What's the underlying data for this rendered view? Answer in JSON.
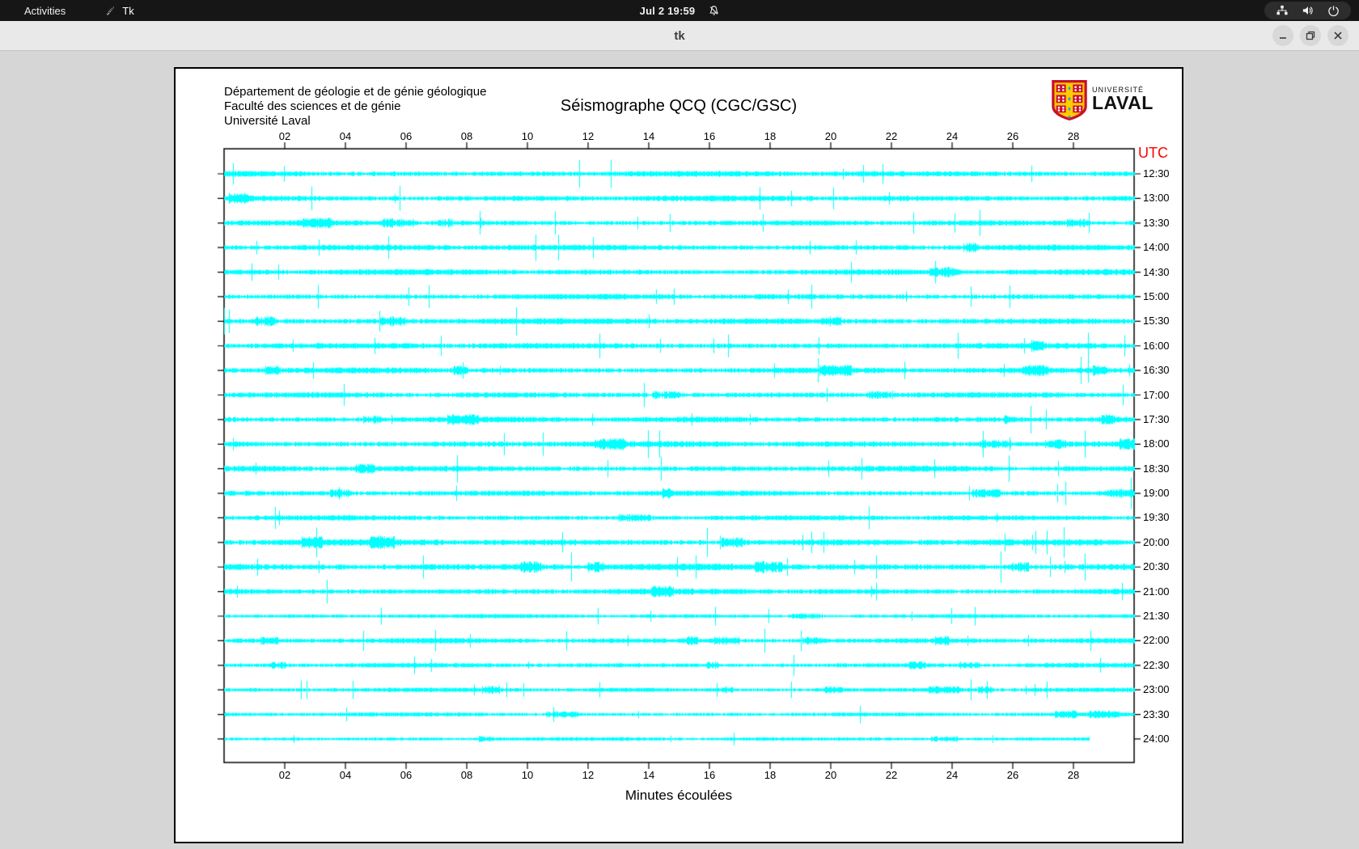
{
  "top_bar": {
    "activities_label": "Activities",
    "app_label": "Tk",
    "clock": "Jul 2 19:59"
  },
  "window": {
    "title": "tk"
  },
  "document": {
    "address_lines": [
      "Département de géologie et de génie géologique",
      "Faculté des sciences et de génie",
      "Université Laval"
    ],
    "title": "Séismographe QCQ (CGC/GSC)",
    "logo": {
      "institution_small": "UNIVERSITÉ",
      "institution_large": "LAVAL"
    }
  },
  "plot": {
    "utc_label": "UTC",
    "utc_color": "#ff0000",
    "xlabel": "Minutes écoulées",
    "trace_color": "#00ffff",
    "frame_color": "#000000",
    "x_tick_labels": [
      "02",
      "04",
      "06",
      "08",
      "10",
      "12",
      "14",
      "16",
      "18",
      "20",
      "22",
      "24",
      "26",
      "28"
    ],
    "row_labels": [
      "12:30",
      "13:00",
      "13:30",
      "14:00",
      "14:30",
      "15:00",
      "15:30",
      "16:00",
      "16:30",
      "17:00",
      "17:30",
      "18:00",
      "18:30",
      "19:00",
      "19:30",
      "20:00",
      "20:30",
      "21:00",
      "21:30",
      "22:00",
      "22:30",
      "23:00",
      "23:30",
      "24:00"
    ]
  },
  "chart_data": {
    "type": "line",
    "subtype": "seismogram-helicorder",
    "title": "Séismographe QCQ (CGC/GSC)",
    "xlabel": "Minutes écoulées",
    "right_axis_label": "UTC",
    "x_range_minutes": [
      0,
      30
    ],
    "x_ticks": [
      2,
      4,
      6,
      8,
      10,
      12,
      14,
      16,
      18,
      20,
      22,
      24,
      26,
      28
    ],
    "trace_color": "#00ffff",
    "rows": [
      {
        "utc": "12:30",
        "start_min": 0,
        "end_min": 30,
        "intensity": 1.0
      },
      {
        "utc": "13:00",
        "start_min": 0,
        "end_min": 30,
        "intensity": 1.0
      },
      {
        "utc": "13:30",
        "start_min": 0,
        "end_min": 30,
        "intensity": 0.95
      },
      {
        "utc": "14:00",
        "start_min": 0,
        "end_min": 30,
        "intensity": 1.0
      },
      {
        "utc": "14:30",
        "start_min": 0,
        "end_min": 30,
        "intensity": 1.0
      },
      {
        "utc": "15:00",
        "start_min": 0,
        "end_min": 30,
        "intensity": 0.95
      },
      {
        "utc": "15:30",
        "start_min": 0,
        "end_min": 30,
        "intensity": 1.05
      },
      {
        "utc": "16:00",
        "start_min": 0,
        "end_min": 30,
        "intensity": 1.0
      },
      {
        "utc": "16:30",
        "start_min": 0,
        "end_min": 30,
        "intensity": 1.0
      },
      {
        "utc": "17:00",
        "start_min": 0,
        "end_min": 30,
        "intensity": 0.95
      },
      {
        "utc": "17:30",
        "start_min": 0,
        "end_min": 30,
        "intensity": 1.0
      },
      {
        "utc": "18:00",
        "start_min": 0,
        "end_min": 30,
        "intensity": 1.05
      },
      {
        "utc": "18:30",
        "start_min": 0,
        "end_min": 30,
        "intensity": 1.0
      },
      {
        "utc": "19:00",
        "start_min": 0,
        "end_min": 30,
        "intensity": 0.95
      },
      {
        "utc": "19:30",
        "start_min": 0,
        "end_min": 30,
        "intensity": 0.9
      },
      {
        "utc": "20:00",
        "start_min": 0,
        "end_min": 30,
        "intensity": 1.1
      },
      {
        "utc": "20:30",
        "start_min": 0,
        "end_min": 30,
        "intensity": 1.15
      },
      {
        "utc": "21:00",
        "start_min": 0,
        "end_min": 30,
        "intensity": 1.0
      },
      {
        "utc": "21:30",
        "start_min": 0,
        "end_min": 30,
        "intensity": 0.7
      },
      {
        "utc": "22:00",
        "start_min": 0,
        "end_min": 30,
        "intensity": 0.9
      },
      {
        "utc": "22:30",
        "start_min": 0,
        "end_min": 30,
        "intensity": 0.8
      },
      {
        "utc": "23:00",
        "start_min": 0,
        "end_min": 30,
        "intensity": 0.75
      },
      {
        "utc": "23:30",
        "start_min": 0,
        "end_min": 30,
        "intensity": 0.7
      },
      {
        "utc": "24:00",
        "start_min": 0,
        "end_min": 28.5,
        "intensity": 0.65
      }
    ],
    "description": "24 half-hour cyan helicorder traces of ambient seismic noise with intermittent spikes; no numeric amplitude labels visible"
  }
}
